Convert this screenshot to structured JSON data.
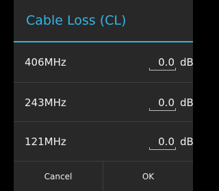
{
  "dialog": {
    "title": "Cable Loss (CL)",
    "rows": [
      {
        "label": "406MHz",
        "value": "0.0",
        "unit": "dB"
      },
      {
        "label": "243MHz",
        "value": "0.0",
        "unit": "dB"
      },
      {
        "label": "121MHz",
        "value": "0.0",
        "unit": "dB"
      }
    ],
    "buttons": {
      "cancel": "Cancel",
      "ok": "OK"
    }
  },
  "colors": {
    "accent": "#35b5e5",
    "background": "#282828"
  }
}
